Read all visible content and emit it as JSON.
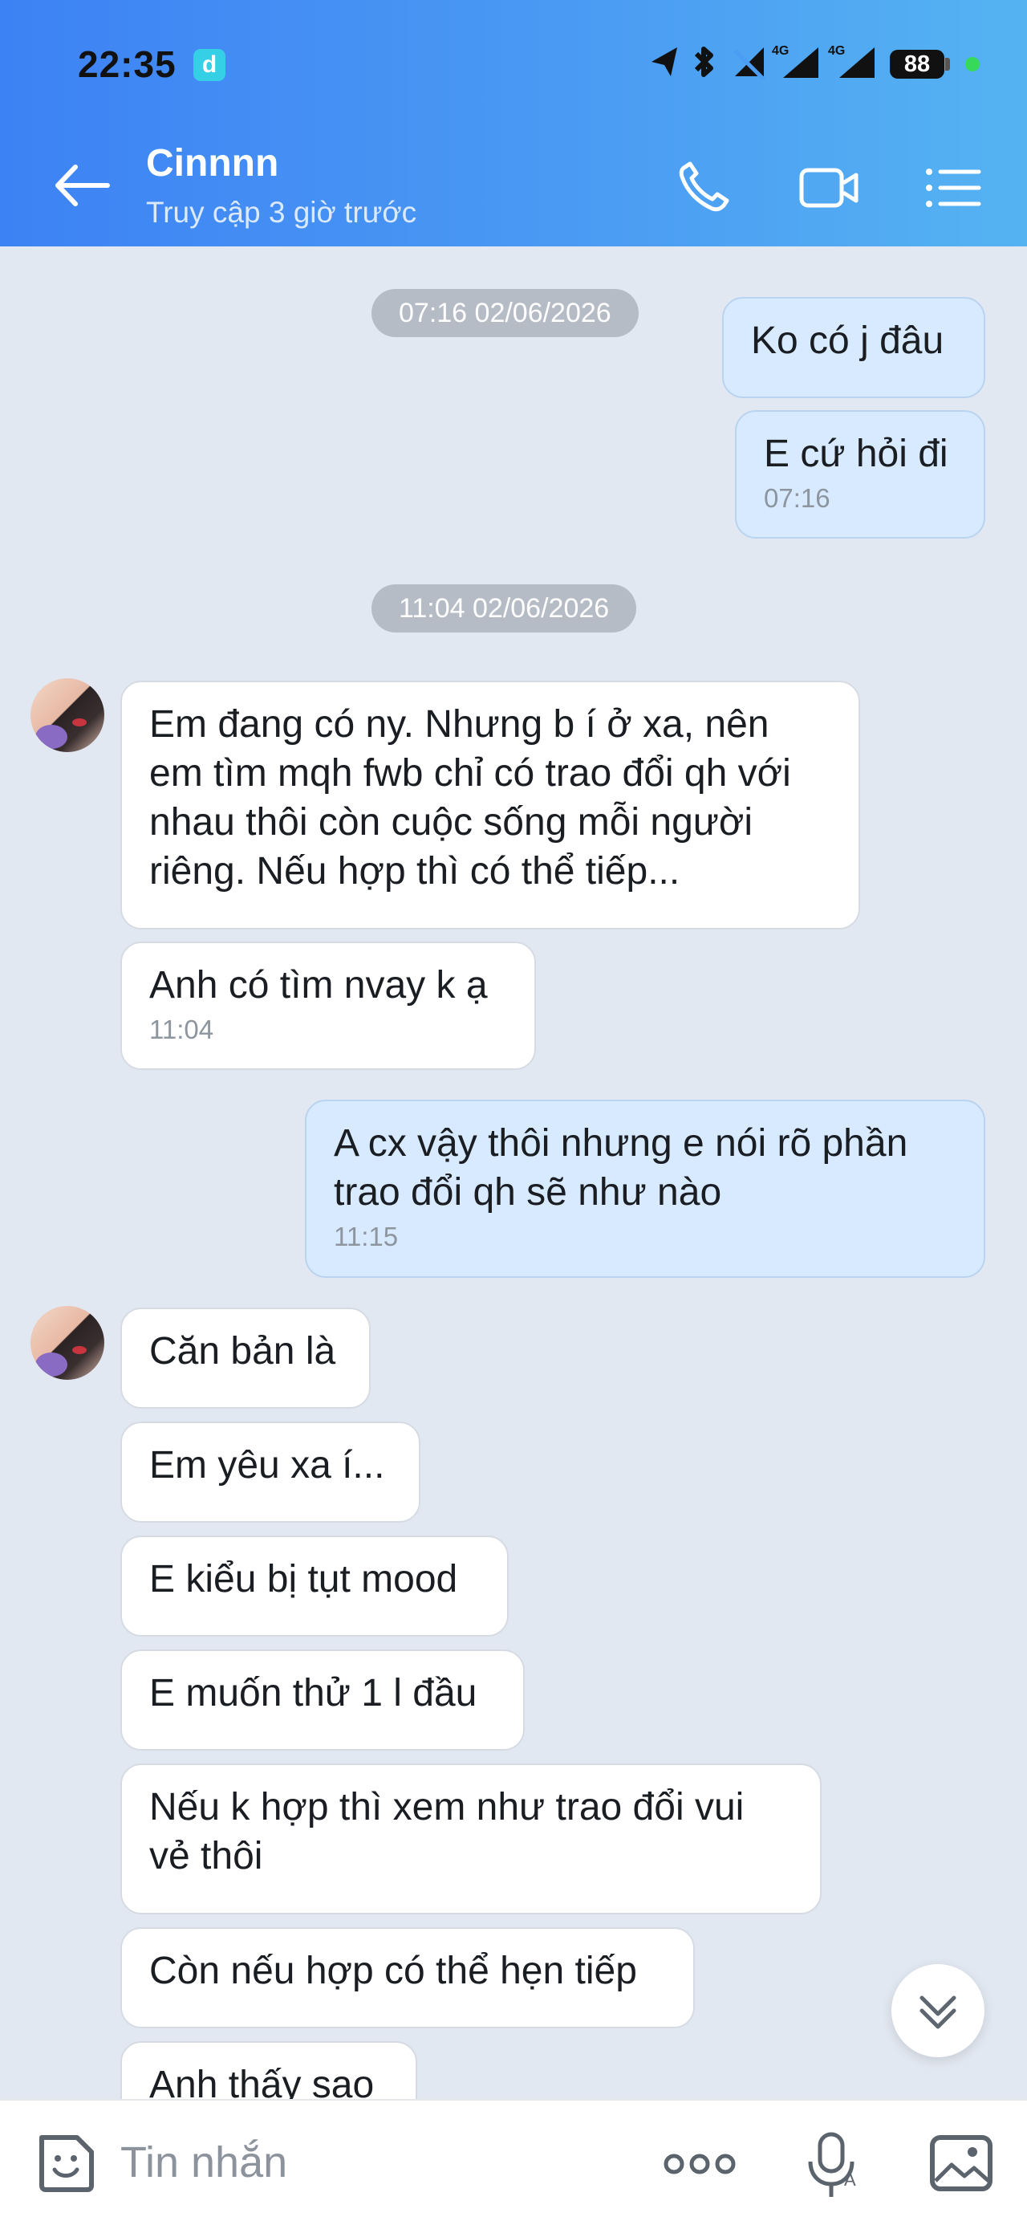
{
  "status_bar": {
    "time": "22:35",
    "app_badge": "d",
    "battery": "88",
    "network_label_1": "4G",
    "network_label_2": "4G"
  },
  "header": {
    "contact_name": "Cinnnn",
    "contact_status": "Truy cập 3 giờ trước",
    "icons": [
      "back-arrow-icon",
      "phone-icon",
      "video-call-icon",
      "menu-list-icon"
    ],
    "gradient": [
      "#3d82f4",
      "#55b3f2"
    ]
  },
  "messages": [
    {
      "type": "separator",
      "text": "07:16 02/06/2026"
    },
    {
      "type": "outgoing",
      "text": "Ko có j đâu",
      "time": ""
    },
    {
      "type": "outgoing",
      "text": "E cứ hỏi đi",
      "time": "07:16"
    },
    {
      "type": "separator",
      "text": "11:04 02/06/2026"
    },
    {
      "type": "incoming",
      "text": "Em đang có ny. Nhưng b í ở xa, nên em tìm mqh fwb chỉ có trao đổi qh với nhau thôi còn cuộc sống mỗi người riêng. Nếu hợp thì có thể tiếp...",
      "time": ""
    },
    {
      "type": "incoming",
      "text": "Anh có tìm nvay k ạ",
      "time": "11:04"
    },
    {
      "type": "outgoing",
      "text": "A cx vậy thôi nhưng e nói rõ phần trao đổi qh sẽ như nào",
      "time": "11:15"
    },
    {
      "type": "incoming",
      "text": "Căn bản là",
      "time": ""
    },
    {
      "type": "incoming",
      "text": "Em yêu xa í...",
      "time": ""
    },
    {
      "type": "incoming",
      "text": "E kiểu bị tụt mood",
      "time": ""
    },
    {
      "type": "incoming",
      "text": "E muốn thử 1 l đầu",
      "time": ""
    },
    {
      "type": "incoming",
      "text": "Nếu k hợp thì xem như trao đổi vui vẻ thôi",
      "time": ""
    },
    {
      "type": "incoming",
      "text": "Còn nếu hợp có thể hẹn tiếp",
      "time": ""
    },
    {
      "type": "incoming",
      "text": "Anh thấy sao",
      "time": ""
    }
  ],
  "input_bar": {
    "placeholder": "Tin nhắn",
    "icons": [
      "sticker-icon",
      "more-icon",
      "voice-icon",
      "image-icon"
    ]
  },
  "colors": {
    "chat_bg": "#e2e8f1",
    "outgoing_bubble": "#d7eaff",
    "incoming_bubble": "#ffffff",
    "separator_bg": "#b6bcc6"
  }
}
